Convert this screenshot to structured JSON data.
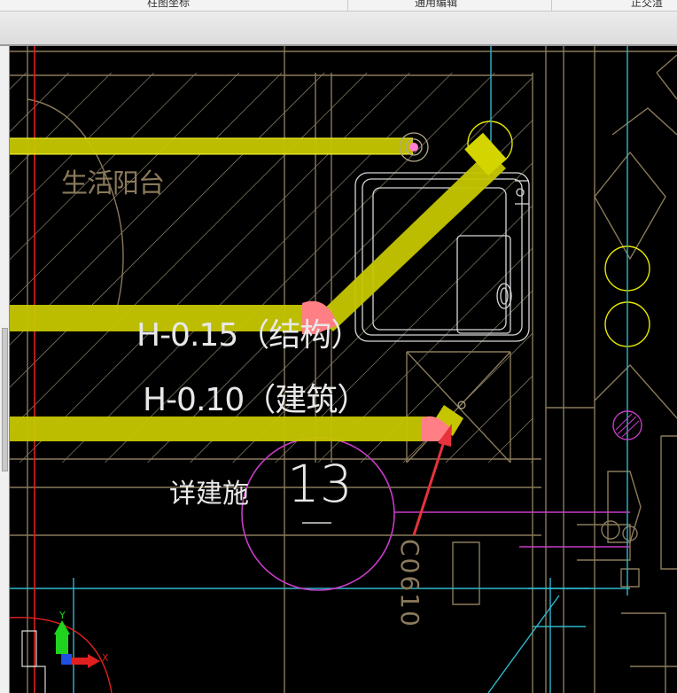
{
  "menu": {
    "tabs": [
      {
        "label": "柱图坐标"
      },
      {
        "label": "通用编辑"
      },
      {
        "label": "正交渲"
      }
    ]
  },
  "drawing": {
    "room_label": "生活阳台",
    "level_structure": "H-0.15（结构）",
    "level_architecture": "H-0.10（建筑）",
    "detail_note": "详建施",
    "detail_number": "13",
    "window_code": "C0610"
  },
  "ucs": {
    "x_label": "X",
    "y_label": "Y"
  },
  "colors": {
    "background": "#000000",
    "hatch": "#b7a98a",
    "pipe_fill": "#c6c600",
    "pipe_highlight": "#ffff33",
    "selection_marker": "#ff7f84",
    "detail_circle": "#c83cc8",
    "grid_line": "#2db7cc",
    "axis_red": "#e02020",
    "arrow_red": "#e8323c",
    "wall_line": "#8a7a5a"
  }
}
